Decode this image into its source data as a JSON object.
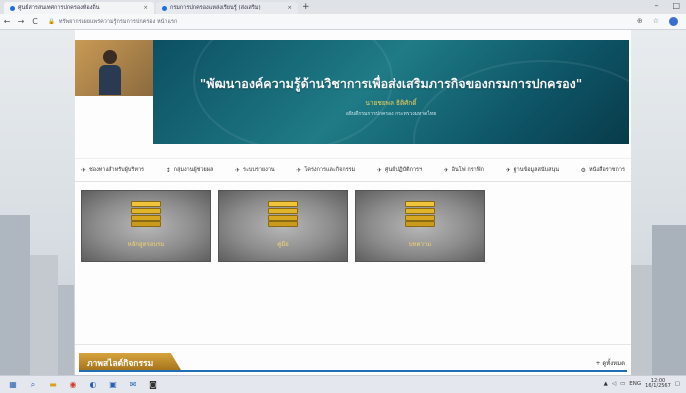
{
  "browser": {
    "tabs": [
      {
        "label": "ศูนย์สารสนเทศการปกครองท้องถิ่น"
      },
      {
        "label": "กรมการปกครองแหล่งเรียนรู้ (ส่งเสริม)"
      }
    ],
    "new_tab": "+",
    "url": "ทรัพยากรเผยแพร่ความรู้กรมการปกครอง หน้าแรก",
    "back": "←",
    "forward": "→",
    "reload": "C"
  },
  "banner": {
    "title": "\"พัฒนาองค์ความรู้ด้านวิชาการเพื่อส่งเสริมภารกิจของกรมการปกครอง\"",
    "subtitle": "นายชยพล ธิติศักดิ์",
    "tagline": "อธิบดีกรมการปกครอง กระทรวงมหาดไทย"
  },
  "menu": {
    "items": [
      {
        "icon": "✈",
        "label": "ช่องทางสำหรับผู้บริหาร"
      },
      {
        "icon": "↕",
        "label": "กลุ่มงานผู้ช่วยผล"
      },
      {
        "icon": "✈",
        "label": "ระบบรายงาน"
      },
      {
        "icon": "✈",
        "label": "โครงการและกิจกรรม"
      },
      {
        "icon": "✈",
        "label": "ศูนย์ปฏิบัติการฯ"
      },
      {
        "icon": "✈",
        "label": "อินโฟ กราฟิก"
      },
      {
        "icon": "✈",
        "label": "ฐานข้อมูลสนับสนุน"
      },
      {
        "icon": "⚙",
        "label": "หนังสือราชการ"
      }
    ]
  },
  "tiles": [
    {
      "label": "หลักสูตรอบรม"
    },
    {
      "label": "คู่มือ"
    },
    {
      "label": "บทความ"
    }
  ],
  "section": {
    "title": "ภาพสไลด์กิจกรรม",
    "more": "+ ดูทั้งหมด"
  },
  "taskbar": {
    "lang": "ENG",
    "time": "12:00",
    "date": "16/1/2567"
  }
}
